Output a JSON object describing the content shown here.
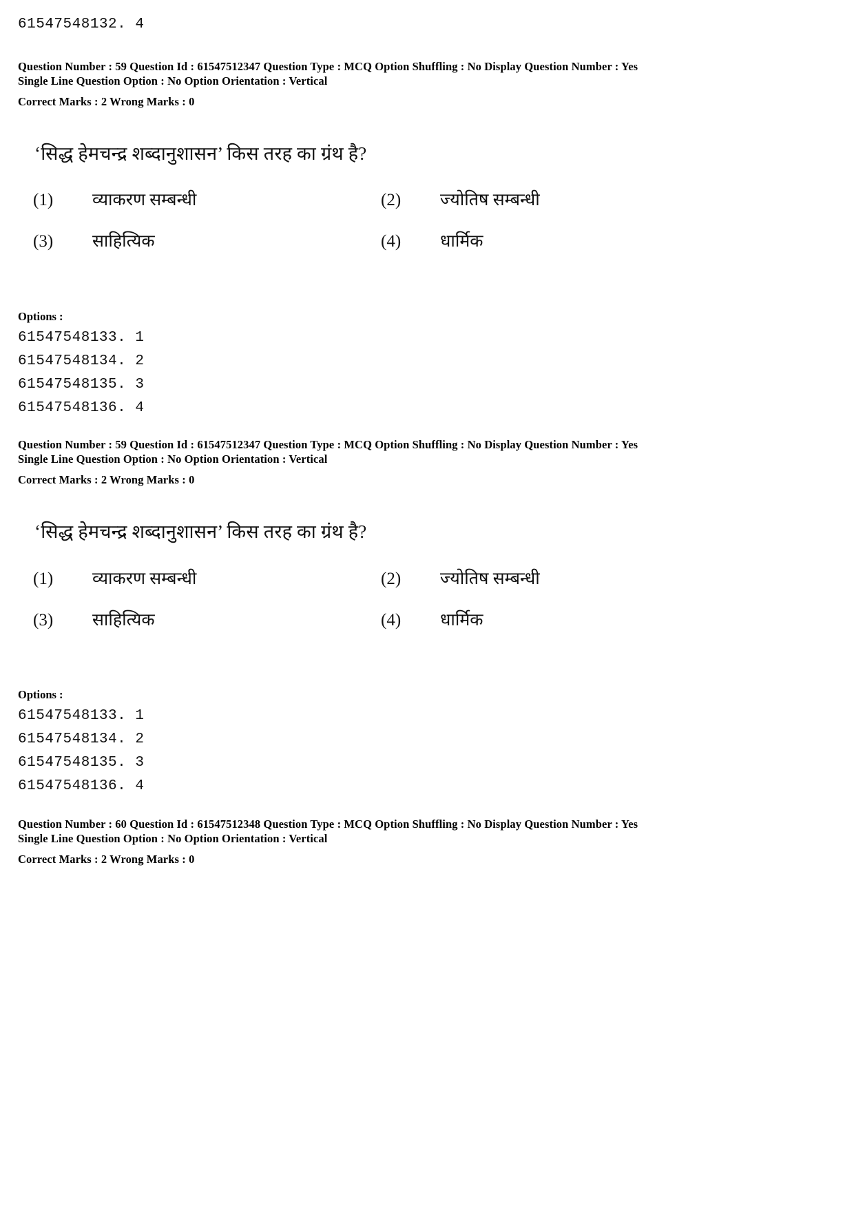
{
  "document": {
    "top_option_id": "61547548132. 4"
  },
  "blocks": [
    {
      "meta": {
        "line1": "Question Number : 59  Question Id : 61547512347  Question Type : MCQ  Option Shuffling : No  Display Question Number : Yes",
        "line2": "Single Line Question Option : No  Option Orientation : Vertical",
        "line3": "Correct Marks : 2  Wrong Marks : 0"
      },
      "question": "‘सिद्ध हेमचन्द्र शब्दानुशासन’ किस तरह का ग्रंथ है?",
      "options": [
        {
          "num": "(1)",
          "text": "व्याकरण सम्बन्धी"
        },
        {
          "num": "(2)",
          "text": "ज्योतिष सम्बन्धी"
        },
        {
          "num": "(3)",
          "text": "साहित्यिक"
        },
        {
          "num": "(4)",
          "text": "धार्मिक"
        }
      ],
      "options_label": "Options :",
      "option_ids": [
        "61547548133. 1",
        "61547548134. 2",
        "61547548135. 3",
        "61547548136. 4"
      ]
    },
    {
      "meta": {
        "line1": "Question Number : 59  Question Id : 61547512347  Question Type : MCQ  Option Shuffling : No  Display Question Number : Yes",
        "line2": "Single Line Question Option : No  Option Orientation : Vertical",
        "line3": "Correct Marks : 2  Wrong Marks : 0"
      },
      "question": "‘सिद्ध हेमचन्द्र शब्दानुशासन’ किस तरह का ग्रंथ है?",
      "options": [
        {
          "num": "(1)",
          "text": "व्याकरण सम्बन्धी"
        },
        {
          "num": "(2)",
          "text": "ज्योतिष सम्बन्धी"
        },
        {
          "num": "(3)",
          "text": "साहित्यिक"
        },
        {
          "num": "(4)",
          "text": "धार्मिक"
        }
      ],
      "options_label": "Options :",
      "option_ids": [
        "61547548133. 1",
        "61547548134. 2",
        "61547548135. 3",
        "61547548136. 4"
      ]
    },
    {
      "meta": {
        "line1": "Question Number : 60  Question Id : 61547512348  Question Type : MCQ  Option Shuffling : No  Display Question Number : Yes",
        "line2": "Single Line Question Option : No  Option Orientation : Vertical",
        "line3": "Correct Marks : 2  Wrong Marks : 0"
      }
    }
  ]
}
